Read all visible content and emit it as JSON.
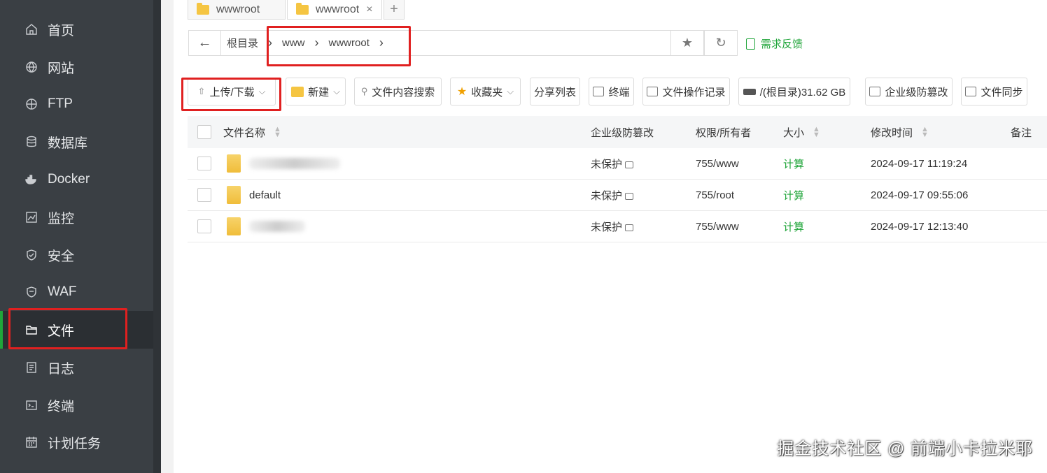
{
  "sidebar": {
    "items": [
      {
        "label": "首页",
        "icon": "home-icon"
      },
      {
        "label": "网站",
        "icon": "globe-icon"
      },
      {
        "label": "FTP",
        "icon": "ftp-globe-icon"
      },
      {
        "label": "数据库",
        "icon": "database-icon"
      },
      {
        "label": "Docker",
        "icon": "docker-icon"
      },
      {
        "label": "监控",
        "icon": "monitor-icon"
      },
      {
        "label": "安全",
        "icon": "shield-icon"
      },
      {
        "label": "WAF",
        "icon": "waf-shield-icon"
      },
      {
        "label": "文件",
        "icon": "folder-icon"
      },
      {
        "label": "日志",
        "icon": "log-icon"
      },
      {
        "label": "终端",
        "icon": "terminal-icon"
      },
      {
        "label": "计划任务",
        "icon": "calendar-icon"
      }
    ],
    "active_index": 8,
    "accent_color": "#20a53a"
  },
  "tabs": [
    {
      "label": "wwwroot"
    },
    {
      "label": "wwwroot",
      "close": "×"
    },
    {
      "label": "+"
    }
  ],
  "address": {
    "back": "←",
    "root": "根目录",
    "parts": [
      "www",
      "wwwroot"
    ],
    "sep": "›",
    "star": "★",
    "refresh": "↻"
  },
  "feedback": "需求反馈",
  "toolbar": {
    "upload": "上传/下载",
    "new": "新建",
    "search": "文件内容搜索",
    "favorites": "收藏夹",
    "share": "分享列表",
    "terminal": "终端",
    "oplog": "文件操作记录",
    "disk": "/(根目录)31.62 GB",
    "tamper": "企业级防篡改",
    "sync": "文件同步"
  },
  "table": {
    "headers": {
      "name": "文件名称",
      "protect": "企业级防篡改",
      "perm": "权限/所有者",
      "size": "大小",
      "mtime": "修改时间",
      "note": "备注"
    },
    "rows": [
      {
        "name": "",
        "protect": "未保护",
        "perm": "755/www",
        "size": "计算",
        "mtime": "2024-09-17 11:19:24"
      },
      {
        "name": "default",
        "protect": "未保护",
        "perm": "755/root",
        "size": "计算",
        "mtime": "2024-09-17 09:55:06"
      },
      {
        "name": "",
        "protect": "未保护",
        "perm": "755/www",
        "size": "计算",
        "mtime": "2024-09-17 12:13:40"
      }
    ]
  },
  "watermark": "掘金技术社区 @ 前端小卡拉米耶"
}
